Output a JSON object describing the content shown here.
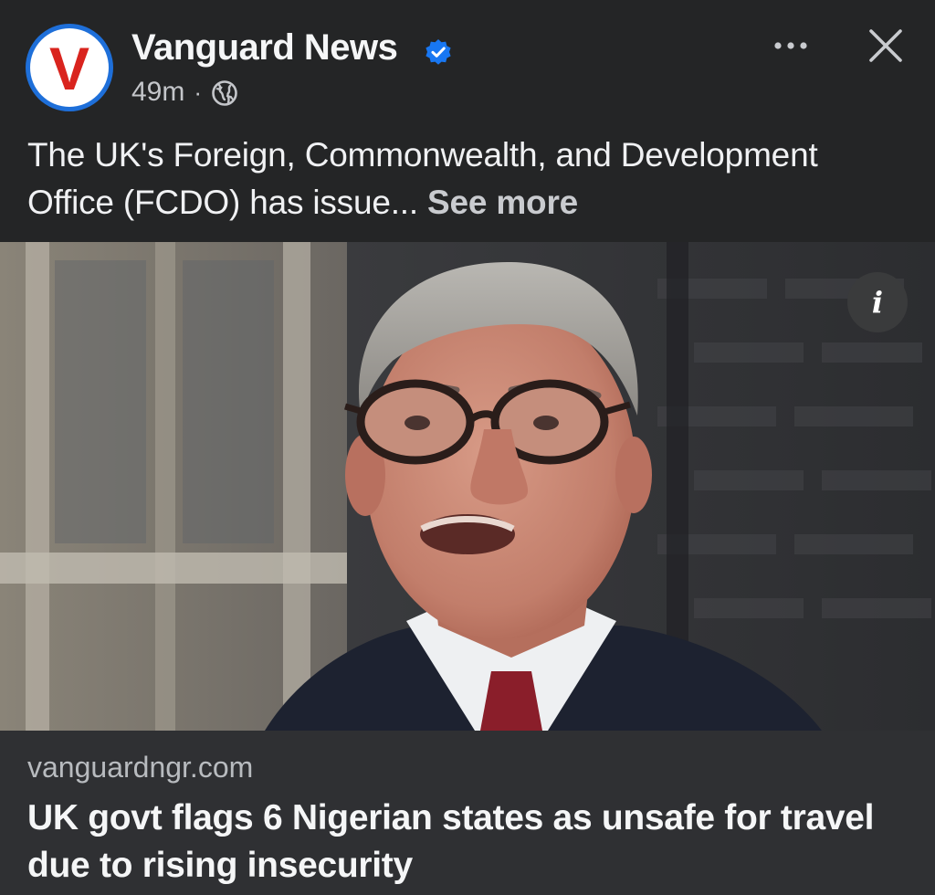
{
  "post": {
    "page_name": "Vanguard News",
    "avatar_letter": "V",
    "time": "49m",
    "separator": "·",
    "text": "The UK's Foreign, Commonwealth, and Development Office (FCDO) has issue...",
    "see_more": "See more"
  },
  "icons": {
    "verified": "verified-badge-icon",
    "globe": "globe-icon",
    "more": "more-options-icon",
    "close": "close-icon",
    "info": "info-icon"
  },
  "info_label": "i",
  "link_preview": {
    "domain": "vanguardngr.com",
    "headline": "UK govt flags 6 Nigerian states as unsafe for travel due to rising insecurity"
  },
  "colors": {
    "background": "#242526",
    "preview_background": "#2f3033",
    "verified": "#1877f2",
    "brand_red": "#d9241e"
  }
}
